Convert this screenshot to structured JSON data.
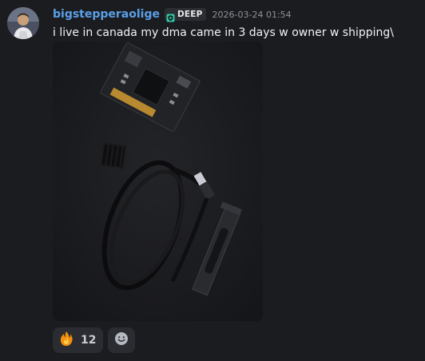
{
  "message": {
    "author": {
      "username": "bigstepperaolige",
      "avatar_icon": "user-avatar",
      "name_color": "#5aa0e8"
    },
    "badge": {
      "icon": "shield-badge-icon",
      "label": "DEEP",
      "color": "#34c7a8"
    },
    "timestamp": "2026-03-24 01:54",
    "text": "i live in canada my dma came in 3 days w owner w shipping\\",
    "attachment": {
      "type": "photo",
      "subject": "pcie dma card, cable and bracket"
    },
    "reactions": [
      {
        "emoji": "🔥",
        "icon": "fire-emoji",
        "count": "12"
      }
    ],
    "add_reaction_icon": "smiley-add-reaction-icon"
  }
}
